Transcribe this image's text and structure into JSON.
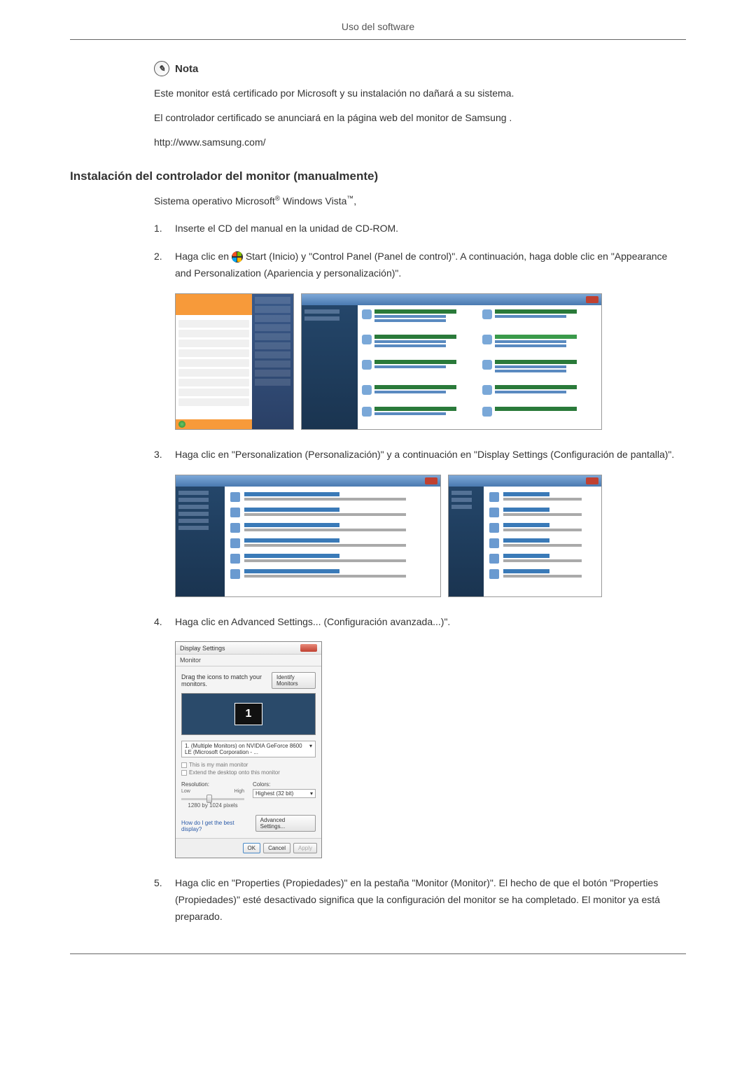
{
  "header": "Uso del software",
  "note": {
    "label": "Nota",
    "line1": "Este monitor está certificado por Microsoft y su instalación no dañará a su sistema.",
    "line2": "El controlador certificado se anunciará en la página web del monitor de Samsung .",
    "url": "http://www.samsung.com/"
  },
  "section_heading": "Instalación del controlador del monitor (manualmente)",
  "os_line_prefix": "Sistema operativo Microsoft",
  "os_line_mid": " Windows Vista",
  "os_line_suffix": ",",
  "steps": {
    "s1": {
      "num": "1.",
      "text": "Inserte el CD del manual en la unidad de CD-ROM."
    },
    "s2": {
      "num": "2.",
      "text_a": "Haga clic en ",
      "text_b": "Start (Inicio) y \"Control Panel (Panel de control)\". A continuación, haga doble clic en \"Appearance and Personalization (Apariencia y personalización)\"."
    },
    "s3": {
      "num": "3.",
      "text": "Haga clic en \"Personalization (Personalización)\" y a continuación en \"Display Settings (Configuración de pantalla)\"."
    },
    "s4": {
      "num": "4.",
      "text": "Haga clic en Advanced Settings... (Configuración avanzada...)\"."
    },
    "s5": {
      "num": "5.",
      "text": "Haga clic en \"Properties (Propiedades)\" en la pestaña \"Monitor (Monitor)\". El hecho de que el botón \"Properties (Propiedades)\" esté desactivado significa que la configuración del monitor se ha completado. El monitor ya está preparado."
    }
  },
  "display_settings": {
    "title": "Display Settings",
    "tab": "Monitor",
    "drag_text": "Drag the icons to match your monitors.",
    "identify_btn": "Identify Monitors",
    "monitor_number": "1",
    "dropdown": "1. (Multiple Monitors) on NVIDIA GeForce 8600 LE (Microsoft Corporation - ...",
    "check1": "This is my main monitor",
    "check2": "Extend the desktop onto this monitor",
    "resolution_label": "Resolution:",
    "res_low": "Low",
    "res_high": "High",
    "res_value": "1280 by 1024 pixels",
    "colors_label": "Colors:",
    "colors_value": "Highest (32 bit)",
    "help_link": "How do I get the best display?",
    "advanced_btn": "Advanced Settings...",
    "ok_btn": "OK",
    "cancel_btn": "Cancel",
    "apply_btn": "Apply"
  }
}
